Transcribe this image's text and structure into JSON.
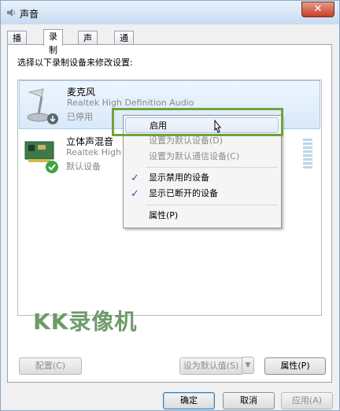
{
  "window": {
    "title": "声音",
    "close_label": "✕"
  },
  "tabs": [
    {
      "label": "播放"
    },
    {
      "label": "录制"
    },
    {
      "label": "声音"
    },
    {
      "label": "通信"
    }
  ],
  "panel": {
    "instruction": "选择以下录制设备来修改设置:"
  },
  "devices": [
    {
      "name": "麦克风",
      "description": "Realtek High Definition Audio",
      "status": "已停用"
    },
    {
      "name": "立体声混音",
      "description": "Realtek High",
      "status": "默认设备"
    }
  ],
  "context_menu": {
    "items": [
      {
        "label": "启用"
      },
      {
        "label": "设置为默认设备(D)"
      },
      {
        "label": "设置为默认通信设备(C)"
      },
      {
        "label": "显示禁用的设备"
      },
      {
        "label": "显示已断开的设备"
      },
      {
        "label": "属性(P)"
      }
    ]
  },
  "watermark": "KK录像机",
  "buttons": {
    "configure": "配置(C)",
    "set_default": "设为默认值(S)",
    "properties": "属性(P)",
    "ok": "确定",
    "cancel": "取消",
    "apply": "应用(A)"
  },
  "colors": {
    "highlight_box": "#6fa33a",
    "selection": "#d9e9fa",
    "check": "#2b54a5"
  }
}
